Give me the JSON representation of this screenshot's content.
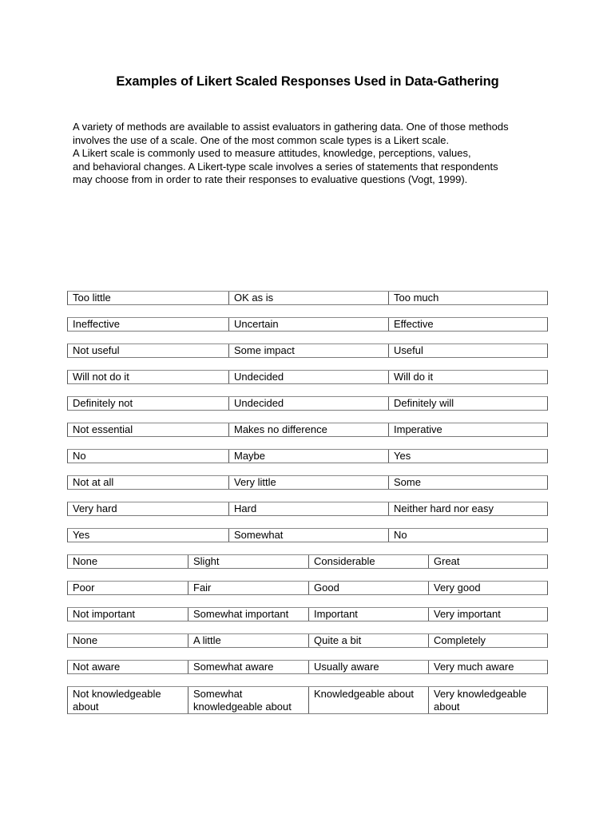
{
  "document": {
    "title": "Examples of Likert Scaled Responses Used in Data-Gathering",
    "intro_lines": [
      "A variety of methods are available to assist evaluators in gathering data. One of those methods",
      "involves the use of a scale.  One of the most common scale types is a Likert scale.",
      "A Likert scale is commonly used to measure attitudes, knowledge, perceptions, values,",
      "and behavioral changes.  A Likert-type scale involves a series of statements that respondents",
      "may choose from in order to rate their responses to evaluative questions (Vogt, 1999)."
    ]
  },
  "scales": [
    [
      "Too little",
      "OK as is",
      "Too much"
    ],
    [
      "Ineffective",
      "Uncertain",
      "Effective"
    ],
    [
      "Not useful",
      "Some impact",
      "Useful"
    ],
    [
      "Will not do it",
      "Undecided",
      "Will do it"
    ],
    [
      "Definitely not",
      "Undecided",
      "Definitely will"
    ],
    [
      "Not essential",
      "Makes no difference",
      "Imperative"
    ],
    [
      "No",
      "Maybe",
      "Yes"
    ],
    [
      "Not at all",
      "Very little",
      "Some"
    ],
    [
      "Very hard",
      "Hard",
      "Neither hard nor easy"
    ],
    [
      "Yes",
      "Somewhat",
      "No"
    ],
    [
      "None",
      "Slight",
      "Considerable",
      "Great"
    ],
    [
      "Poor",
      "Fair",
      "Good",
      "Very good"
    ],
    [
      "Not important",
      "Somewhat important",
      "Important",
      "Very important"
    ],
    [
      "None",
      "A little",
      "Quite a bit",
      "Completely"
    ],
    [
      "Not aware",
      "Somewhat aware",
      "Usually aware",
      "Very much aware"
    ],
    [
      "Not knowledgeable about",
      "Somewhat knowledgeable about",
      "Knowledgeable about",
      "Very knowledgeable about"
    ]
  ]
}
